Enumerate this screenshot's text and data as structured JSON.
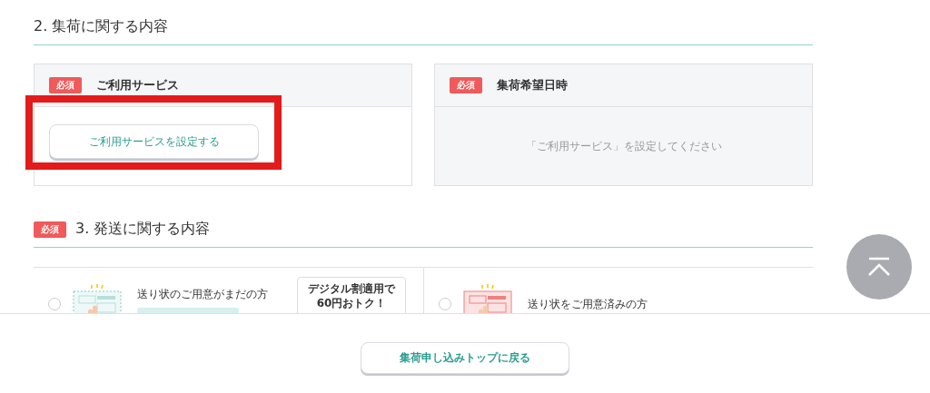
{
  "section_2": {
    "title": "2. 集荷に関する内容",
    "cards": [
      {
        "kind": "button",
        "badge": "必須",
        "title": "ご利用サービス",
        "button": "ご利用サービスを設定する",
        "highlight": true
      },
      {
        "kind": "message",
        "badge": "必須",
        "title": "集荷希望日時",
        "message": "「ご利用サービス」を設定してください",
        "highlight": false
      }
    ]
  },
  "section_3": {
    "badge": "必須",
    "title": "3. 発送に関する内容",
    "options": [
      {
        "kind": "blank",
        "label": "送り状のご用意がまだの方",
        "selected": false,
        "promo": "デジタル割適用で\n60円おトク！"
      },
      {
        "kind": "filled",
        "label": "送り状をご用意済みの方",
        "selected": false
      }
    ]
  },
  "footer": {
    "button": "集荷申し込みトップに戻る"
  }
}
